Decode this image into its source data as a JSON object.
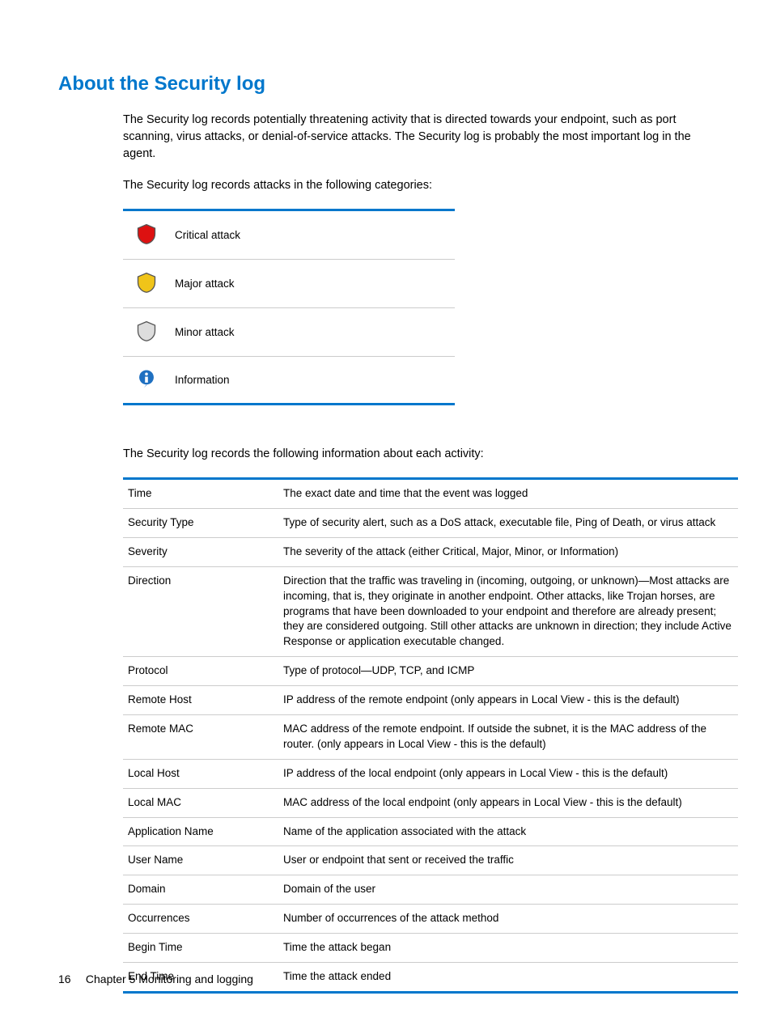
{
  "title": "About the Security log",
  "paragraphs": {
    "p1": "The Security log records potentially threatening activity that is directed towards your endpoint, such as port scanning, virus attacks, or denial-of-service attacks. The Security log is probably the most important log in the agent.",
    "p2": "The Security log records attacks in the following categories:",
    "p3": "The Security log records the following information about each activity:"
  },
  "categories": [
    {
      "icon": "shield-red",
      "label": "Critical attack"
    },
    {
      "icon": "shield-yellow",
      "label": "Major attack"
    },
    {
      "icon": "shield-gray",
      "label": "Minor attack"
    },
    {
      "icon": "info",
      "label": "Information"
    }
  ],
  "fields": [
    {
      "name": "Time",
      "desc": "The exact date and time that the event was logged"
    },
    {
      "name": "Security Type",
      "desc": "Type of security alert, such as a DoS attack, executable file, Ping of Death, or virus attack"
    },
    {
      "name": "Severity",
      "desc": "The severity of the attack (either Critical, Major, Minor, or Information)"
    },
    {
      "name": "Direction",
      "desc": "Direction that the traffic was traveling in (incoming, outgoing, or unknown)—Most attacks are incoming, that is, they originate in another endpoint. Other attacks, like Trojan horses, are programs that have been downloaded to your endpoint and therefore are already present; they are considered outgoing. Still other attacks are unknown in direction; they include Active Response or application executable changed."
    },
    {
      "name": "Protocol",
      "desc": "Type of protocol—UDP, TCP, and ICMP"
    },
    {
      "name": "Remote Host",
      "desc": "IP address of the remote endpoint (only appears in Local View - this is the default)"
    },
    {
      "name": "Remote MAC",
      "desc": "MAC address of the remote endpoint. If outside the subnet, it is the MAC address of the router. (only appears in Local View - this is the default)"
    },
    {
      "name": "Local Host",
      "desc": "IP address of the local endpoint (only appears in Local View - this is the default)"
    },
    {
      "name": "Local MAC",
      "desc": "MAC address of the local endpoint (only appears in Local View - this is the default)"
    },
    {
      "name": "Application Name",
      "desc": "Name of the application associated with the attack"
    },
    {
      "name": "User Name",
      "desc": "User or endpoint that sent or received the traffic"
    },
    {
      "name": "Domain",
      "desc": "Domain of the user"
    },
    {
      "name": "Occurrences",
      "desc": "Number of occurrences of the attack method"
    },
    {
      "name": "Begin Time",
      "desc": "Time the attack began"
    },
    {
      "name": "End Time",
      "desc": "Time the attack ended"
    }
  ],
  "footer": {
    "page_number": "16",
    "chapter": "Chapter 5   Monitoring and logging"
  }
}
